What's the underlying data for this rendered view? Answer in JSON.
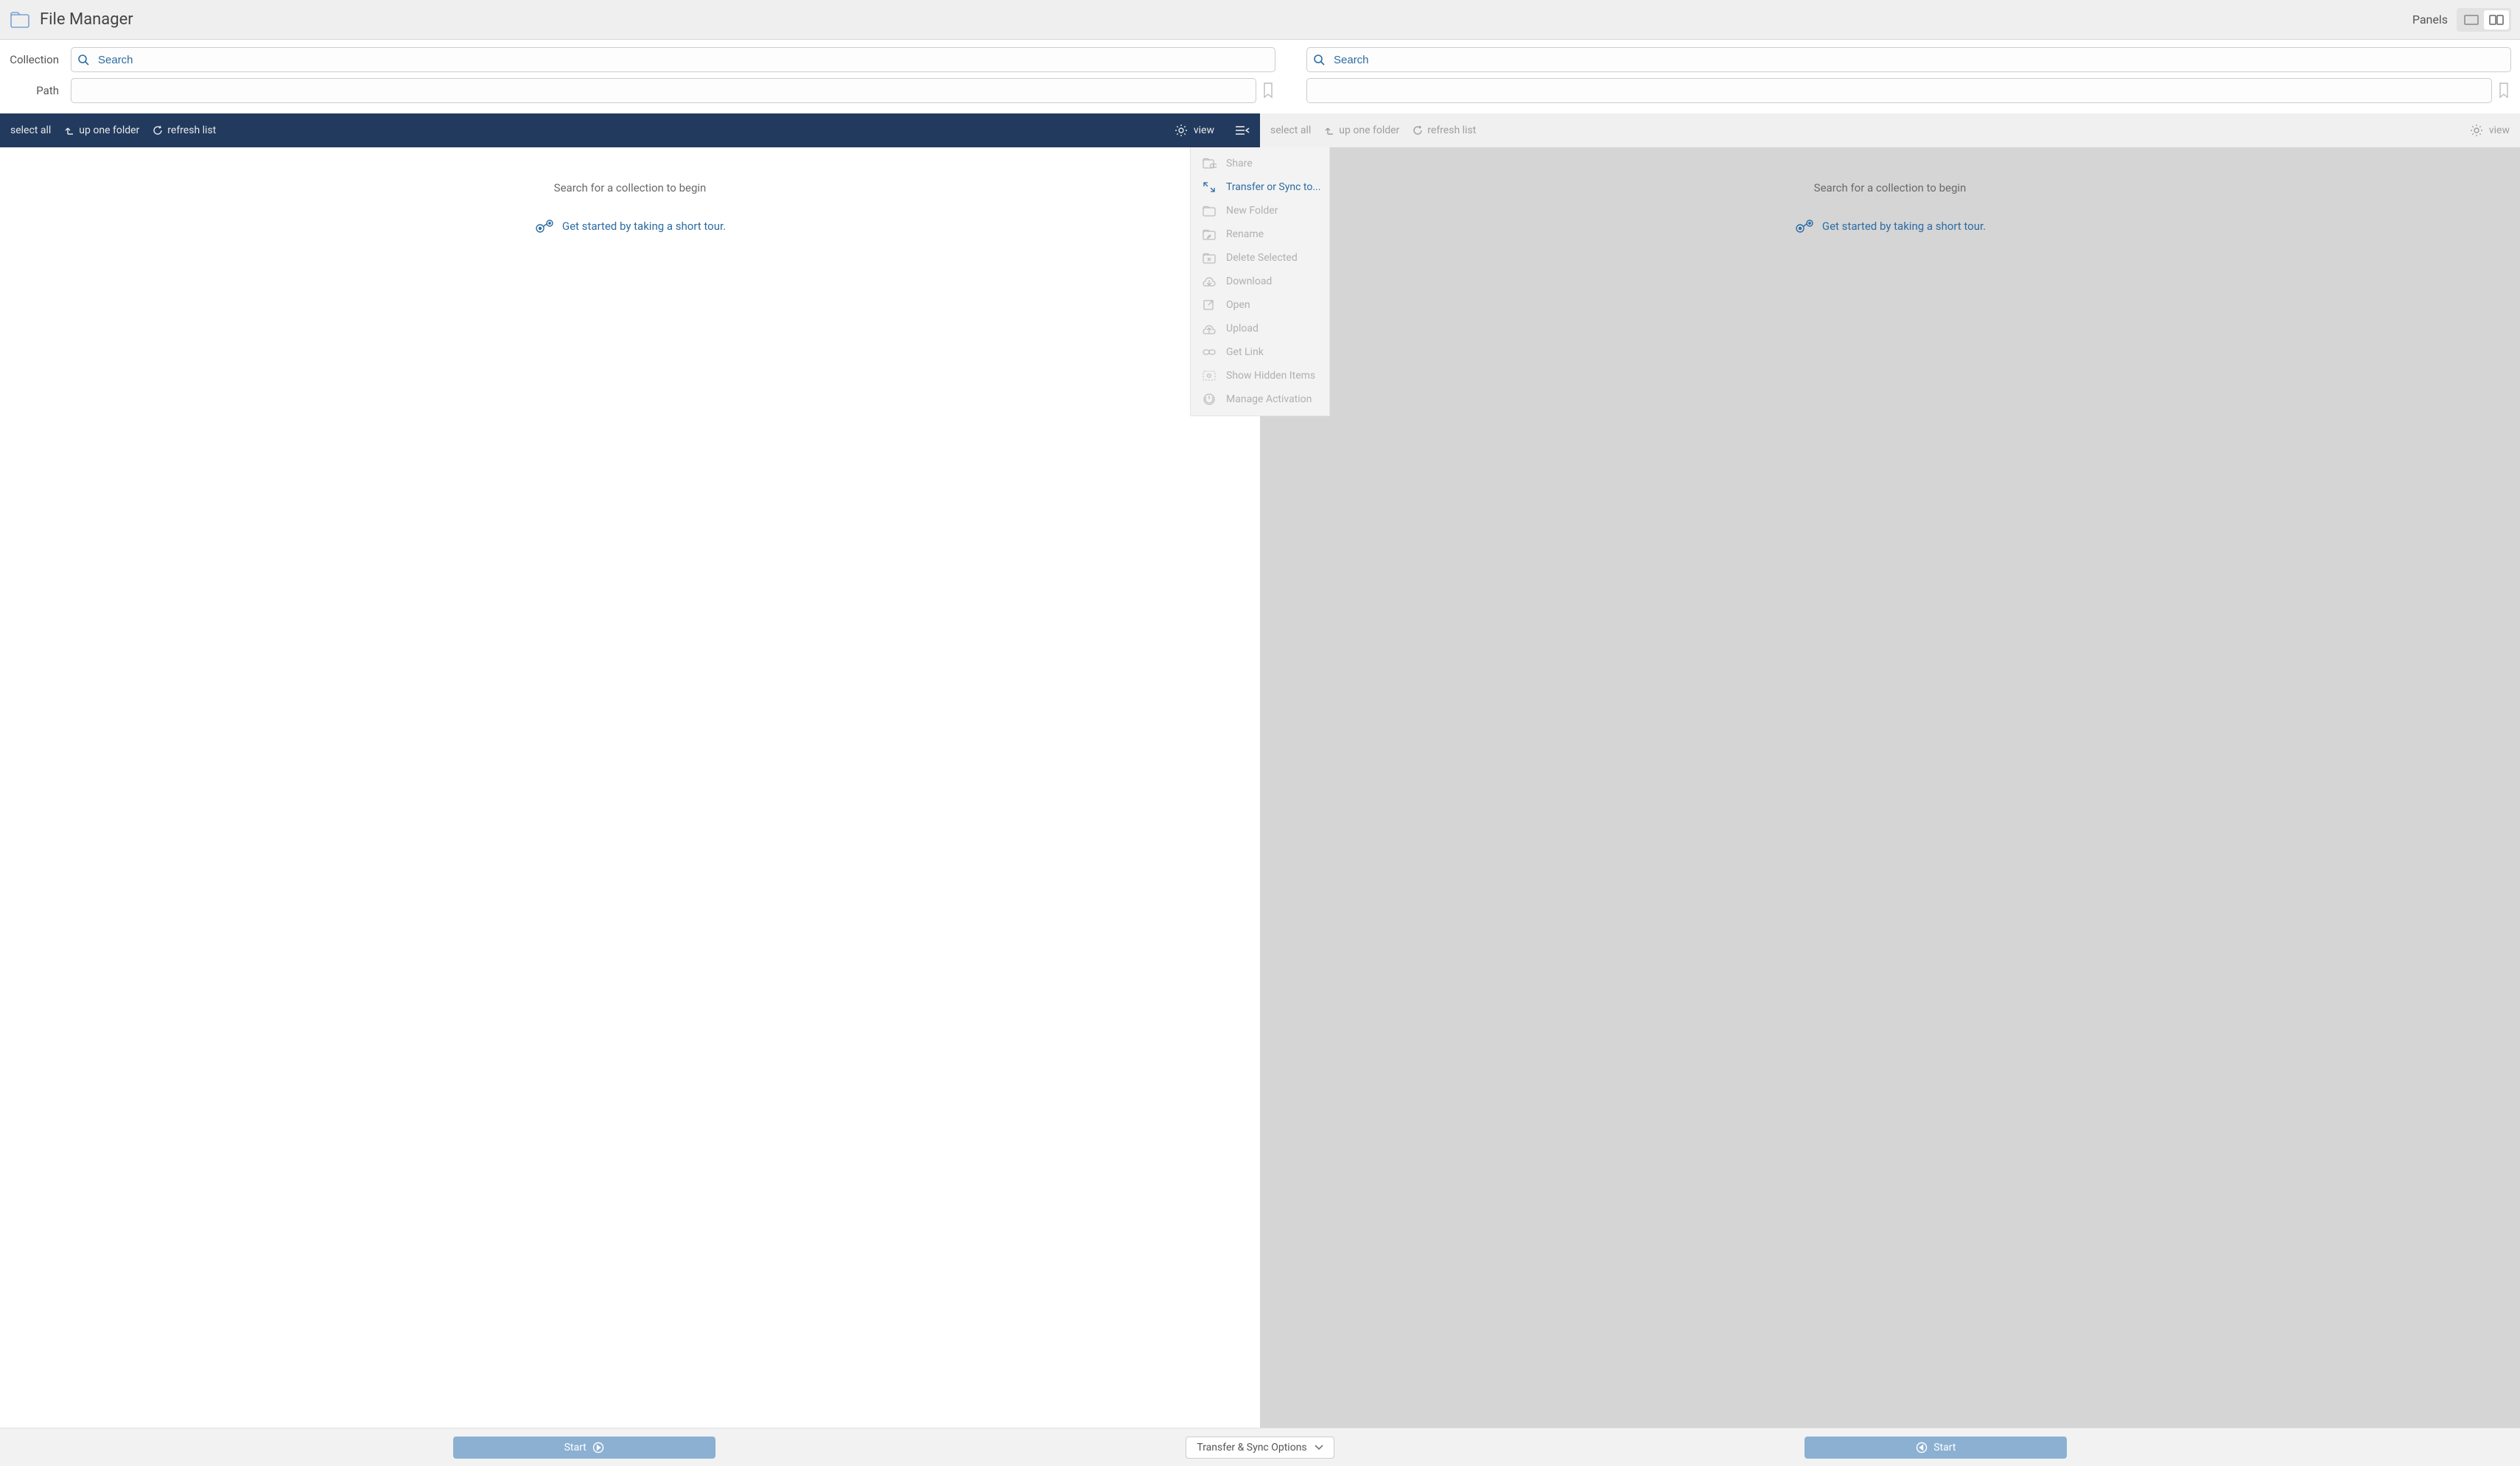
{
  "header": {
    "title": "File Manager",
    "panels_label": "Panels"
  },
  "fields": {
    "collection_label": "Collection",
    "path_label": "Path",
    "search_placeholder": "Search"
  },
  "toolbar": {
    "select_all": "select all",
    "up_one_folder": "up one folder",
    "refresh_list": "refresh list",
    "view": "view"
  },
  "empty_state": {
    "message": "Search for a collection to begin",
    "tour_text": "Get started by taking a short tour."
  },
  "center_menu": {
    "items": [
      {
        "id": "share",
        "label": "Share",
        "enabled": false
      },
      {
        "id": "transfer",
        "label": "Transfer or Sync to...",
        "enabled": true
      },
      {
        "id": "new_folder",
        "label": "New Folder",
        "enabled": false
      },
      {
        "id": "rename",
        "label": "Rename",
        "enabled": false
      },
      {
        "id": "delete",
        "label": "Delete Selected",
        "enabled": false
      },
      {
        "id": "download",
        "label": "Download",
        "enabled": false
      },
      {
        "id": "open",
        "label": "Open",
        "enabled": false
      },
      {
        "id": "upload",
        "label": "Upload",
        "enabled": false
      },
      {
        "id": "get_link",
        "label": "Get Link",
        "enabled": false
      },
      {
        "id": "show_hidden",
        "label": "Show Hidden Items",
        "enabled": false
      },
      {
        "id": "activation",
        "label": "Manage Activation",
        "enabled": false
      }
    ]
  },
  "footer": {
    "start_label": "Start",
    "transfer_options_label": "Transfer & Sync Options"
  }
}
